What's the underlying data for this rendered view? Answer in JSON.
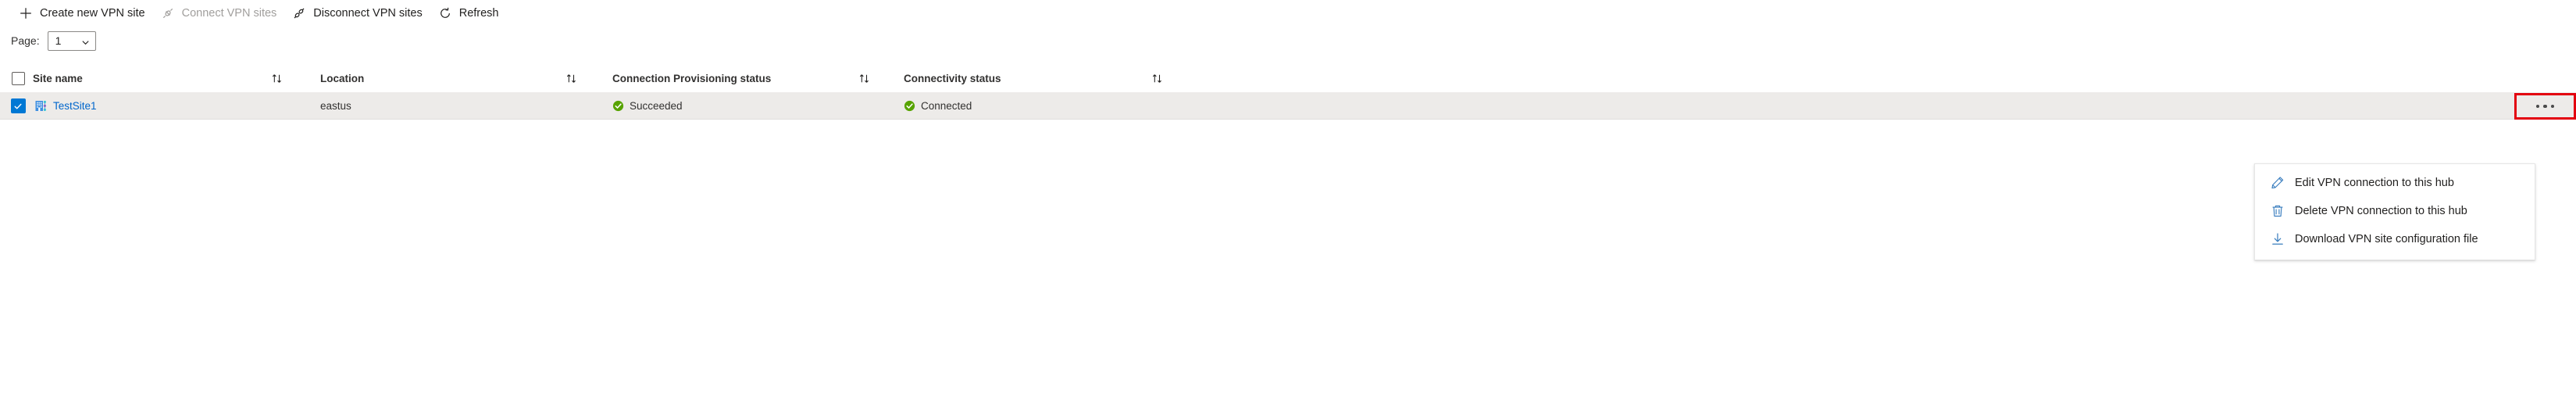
{
  "toolbar": {
    "buttons": [
      {
        "label": "Create new VPN site",
        "icon": "plus-icon",
        "disabled": false
      },
      {
        "label": "Connect VPN sites",
        "icon": "connect-plug-icon",
        "disabled": true
      },
      {
        "label": "Disconnect VPN sites",
        "icon": "disconnect-plug-icon",
        "disabled": false
      },
      {
        "label": "Refresh",
        "icon": "refresh-icon",
        "disabled": false
      }
    ]
  },
  "pager": {
    "label": "Page:",
    "value": "1",
    "chevron_icon": "chevron-down-icon"
  },
  "table": {
    "columns": [
      {
        "label": "Site name",
        "sort_icon": "sort-updown-icon"
      },
      {
        "label": "Location",
        "sort_icon": "sort-updown-icon"
      },
      {
        "label": "Connection Provisioning status",
        "sort_icon": "sort-updown-icon"
      },
      {
        "label": "Connectivity status",
        "sort_icon": "sort-updown-icon"
      }
    ],
    "select_all_checkbox": {
      "checked": false,
      "icon": "checkbox-icon"
    },
    "rows": [
      {
        "selected": true,
        "row_checkbox_icon": "checkbox-checked-icon",
        "site_icon": "vpn-site-icon",
        "site_name": "TestSite1",
        "location": "eastus",
        "provisioning_status": "Succeeded",
        "provisioning_status_icon": "success-check-circle-icon",
        "connectivity_status": "Connected",
        "connectivity_status_icon": "success-check-circle-icon",
        "actions_icon": "ellipsis-icon"
      }
    ]
  },
  "context_menu": {
    "items": [
      {
        "label": "Edit VPN connection to this hub",
        "icon": "pencil-edit-icon"
      },
      {
        "label": "Delete VPN connection to this hub",
        "icon": "trash-delete-icon"
      },
      {
        "label": "Download VPN site configuration file",
        "icon": "download-arrow-icon"
      }
    ]
  },
  "colors": {
    "accent": "#0078d4",
    "link": "#0066cc",
    "success": "#57a300",
    "highlight_border": "#e3000f",
    "row_selected_bg": "#edebe9"
  }
}
